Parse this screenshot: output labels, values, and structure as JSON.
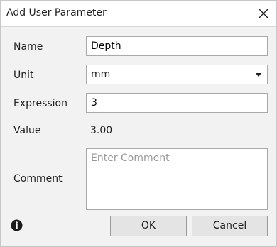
{
  "dialog": {
    "title": "Add User Parameter"
  },
  "form": {
    "name_label": "Name",
    "name_value": "Depth",
    "unit_label": "Unit",
    "unit_value": "mm",
    "expression_label": "Expression",
    "expression_value": "3",
    "value_label": "Value",
    "value_text": "3.00",
    "comment_label": "Comment",
    "comment_placeholder": "Enter Comment"
  },
  "buttons": {
    "ok_label": "OK",
    "cancel_label": "Cancel"
  },
  "icons": {
    "close": "close-icon",
    "info": "info-icon",
    "dropdown": "chevron-down-icon"
  }
}
